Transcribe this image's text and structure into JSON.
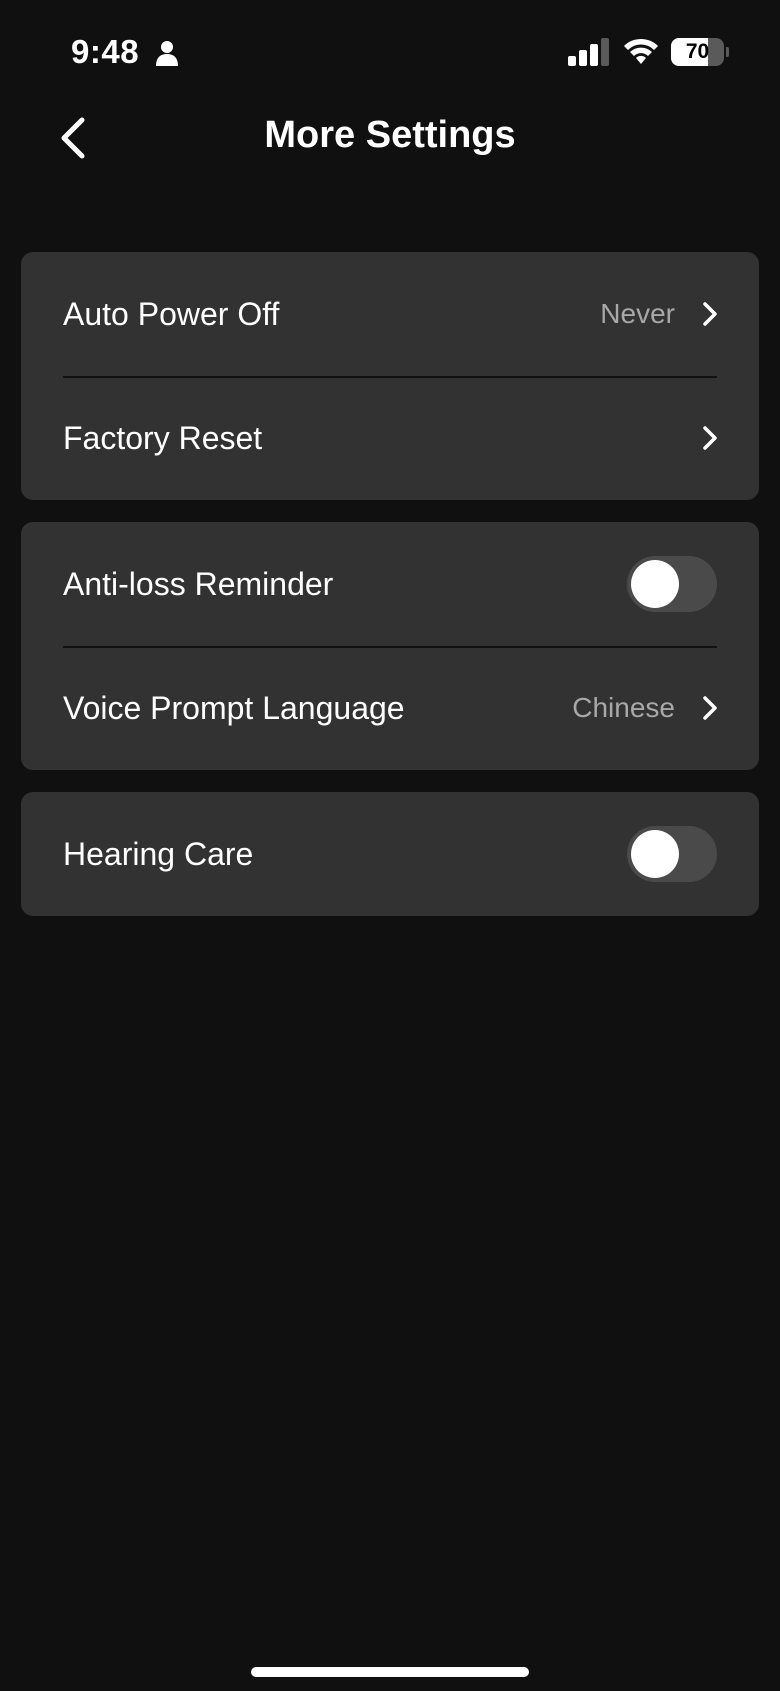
{
  "status_bar": {
    "time": "9:48",
    "battery_percent": "70",
    "battery_level": 0.7,
    "icons": [
      "person-icon",
      "signal-icon",
      "wifi-icon",
      "battery-icon"
    ]
  },
  "nav": {
    "title": "More Settings",
    "back_icon": "chevron-left-icon"
  },
  "groups": [
    {
      "rows": [
        {
          "label": "Auto Power Off",
          "value": "Never",
          "control": "chevron"
        },
        {
          "label": "Factory Reset",
          "value": "",
          "control": "chevron"
        }
      ]
    },
    {
      "rows": [
        {
          "label": "Anti-loss Reminder",
          "control": "toggle",
          "on": false
        },
        {
          "label": "Voice Prompt Language",
          "value": "Chinese",
          "control": "chevron"
        }
      ]
    },
    {
      "rows": [
        {
          "label": "Hearing Care",
          "control": "toggle",
          "on": false
        }
      ]
    }
  ],
  "colors": {
    "background": "#101010",
    "card": "#323232",
    "secondary_text": "#a8a8a8",
    "toggle_off": "#4a4a4a"
  }
}
